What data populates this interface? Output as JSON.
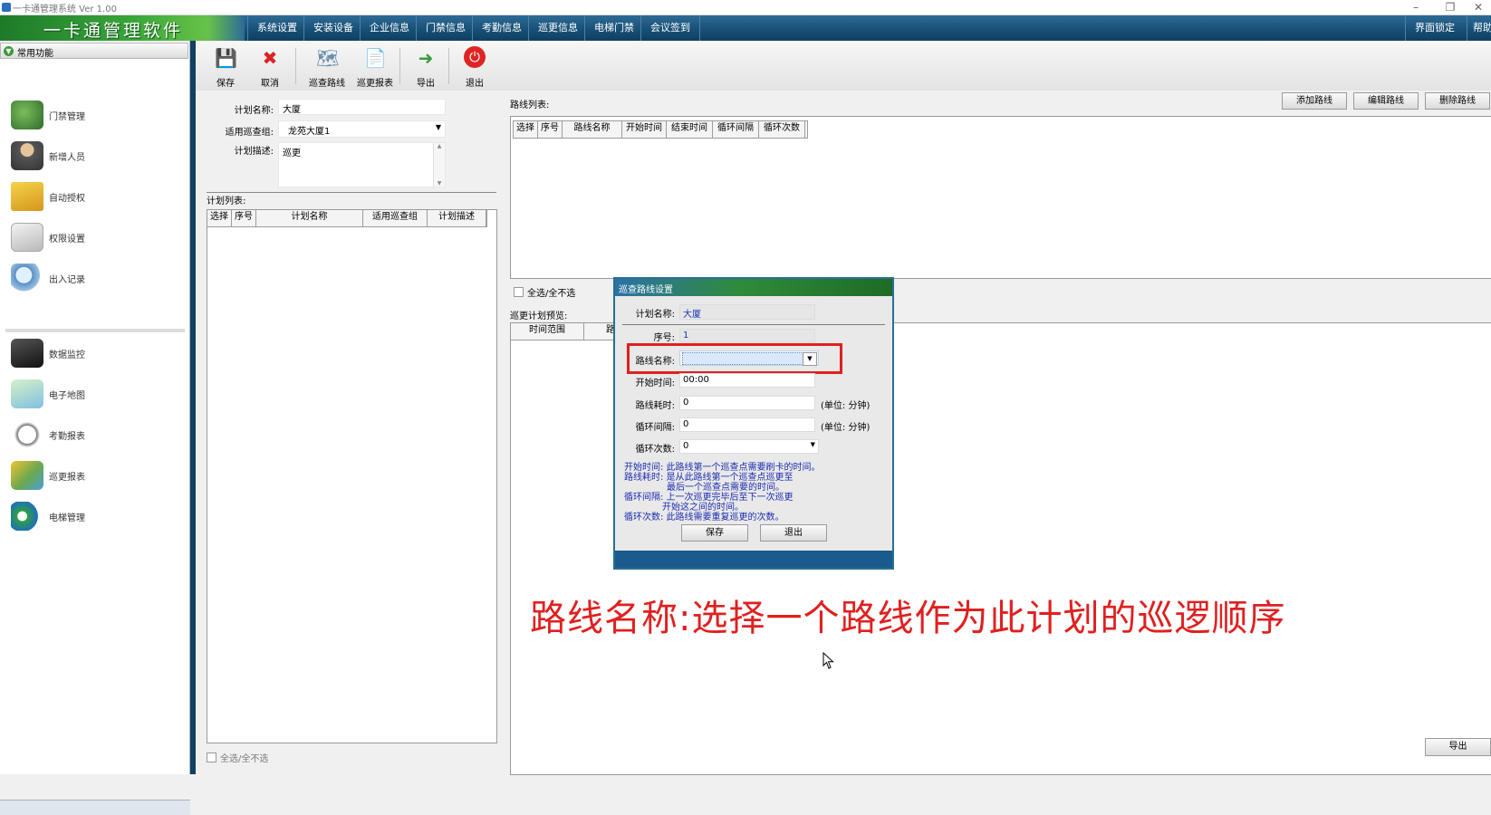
{
  "window": {
    "title": "一卡通管理系统 Ver 1.00",
    "controls": [
      "–",
      "❐",
      "✕"
    ]
  },
  "header": {
    "brand": "一卡通管理软件",
    "menu": [
      "系统设置",
      "安装设备",
      "企业信息",
      "门禁信息",
      "考勤信息",
      "巡更信息",
      "电梯门禁",
      "会议签到"
    ],
    "right": [
      "界面锁定",
      "帮助"
    ]
  },
  "sidebar": {
    "title": "常用功能",
    "items": [
      "门禁管理",
      "新增人员",
      "自动授权",
      "权限设置",
      "出入记录",
      "数据监控",
      "电子地图",
      "考勤报表",
      "巡更报表",
      "电梯管理"
    ]
  },
  "toolbar": {
    "buttons": [
      "保存",
      "取消",
      "巡查路线",
      "巡更报表",
      "导出",
      "退出"
    ]
  },
  "plan_form": {
    "name_label": "计划名称:",
    "name_value": "大厦",
    "group_label": "适用巡查组:",
    "group_value": "龙苑大厦1",
    "desc_label": "计划描述:",
    "desc_value": "巡更"
  },
  "plan_list": {
    "title": "计划列表:",
    "columns": [
      "选择",
      "序号",
      "计划名称",
      "适用巡查组",
      "计划描述"
    ],
    "select_all": "全选/全不选"
  },
  "route_list": {
    "title": "路线列表:",
    "columns": [
      "选择",
      "序号",
      "路线名称",
      "开始时间",
      "结束时间",
      "循环间隔",
      "循环次数"
    ],
    "buttons": [
      "添加路线",
      "编辑路线",
      "删除路线"
    ],
    "select_all": "全选/全不选"
  },
  "preview": {
    "title": "巡更计划预览:",
    "columns": [
      "时间范围",
      "路"
    ],
    "export": "导出"
  },
  "dialog": {
    "title": "巡查路线设置",
    "plan_name_label": "计划名称:",
    "plan_name_value": "大厦",
    "seq_label": "序号:",
    "seq_value": "1",
    "route_name_label": "路线名称:",
    "route_name_value": "",
    "start_label": "开始时间:",
    "start_value": "00:00",
    "duration_label": "路线耗时:",
    "duration_value": "0",
    "duration_unit": "(单位: 分钟)",
    "interval_label": "循环间隔:",
    "interval_value": "0",
    "interval_unit": "(单位: 分钟)",
    "count_label": "循环次数:",
    "count_value": "0",
    "notes": [
      "开始时间: 此路线第一个巡查点需要刷卡的时间。",
      "路线耗时: 是从此路线第一个巡查点巡更至",
      "最后一个巡查点需要的时间。",
      "循环间隔: 上一次巡更完毕后至下一次巡更",
      "开始这之间的时间。",
      "循环次数: 此路线需要重复巡更的次数。"
    ],
    "save": "保存",
    "exit": "退出"
  },
  "caption": "路线名称:选择一个路线作为此计划的巡逻顺序",
  "colors": {
    "highlight": "#e02020",
    "header": "#174e74",
    "brand_green": "#3aa63a"
  }
}
